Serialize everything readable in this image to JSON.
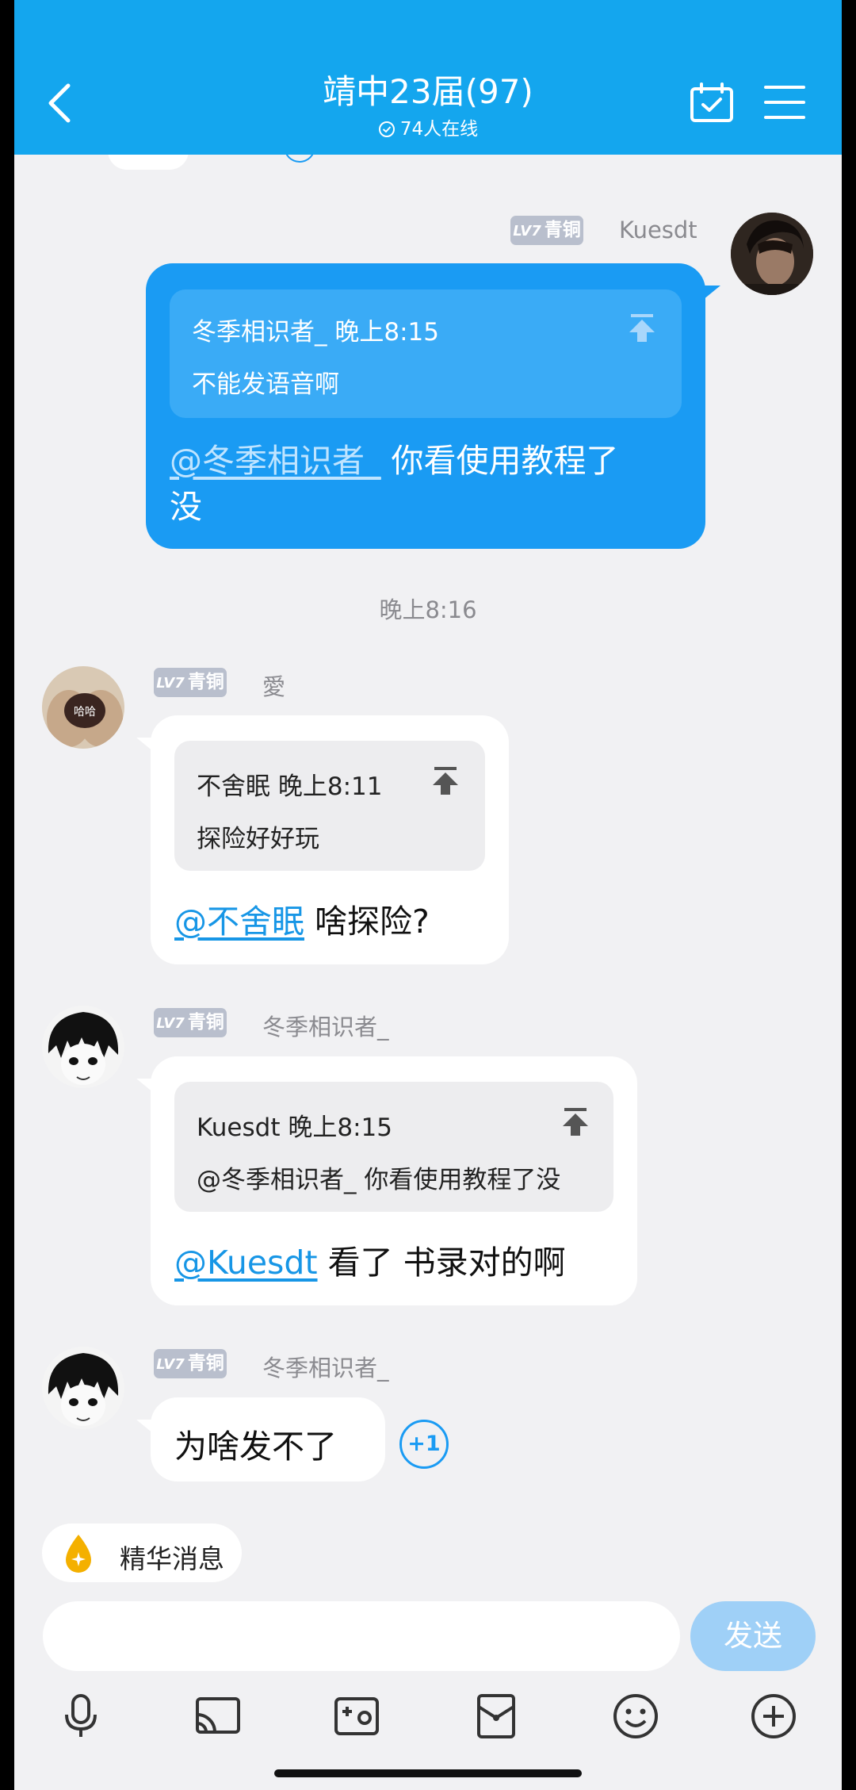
{
  "header": {
    "title": "靖中23届(97)",
    "online": "74人在线"
  },
  "messages": [
    {
      "sender": {
        "level": "LV7",
        "rank": "青铜",
        "name": "Kuesdt"
      },
      "quote": {
        "author_time": "冬季相识者_ 晚上8:15",
        "text": "不能发语音啊"
      },
      "mention": "@冬季相识者_",
      "text_line1": " 你看使用教程了",
      "text_line2": "没"
    },
    {
      "sender": {
        "level": "LV7",
        "rank": "青铜",
        "name": "愛"
      },
      "quote": {
        "author_time": "不舍眠 晚上8:11",
        "text": "探险好好玩"
      },
      "mention": "@不舍眠",
      "text": " 啥探险?"
    },
    {
      "sender": {
        "level": "LV7",
        "rank": "青铜",
        "name": "冬季相识者_"
      },
      "quote": {
        "author_time": "Kuesdt 晚上8:15",
        "text": "@冬季相识者_ 你看使用教程了没"
      },
      "mention": "@Kuesdt",
      "text": " 看了 书录对的啊"
    },
    {
      "sender": {
        "level": "LV7",
        "rank": "青铜",
        "name": "冬季相识者_"
      },
      "text": "为啥发不了",
      "plus_one": "+1"
    }
  ],
  "timestamp": "晚上8:16",
  "avatar_text": "哈哈",
  "essence_label": "精华消息",
  "input": {
    "value": "",
    "send_label": "发送"
  },
  "toolbar": [
    "microphone-icon",
    "screen-share-icon",
    "photo-icon",
    "red-packet-icon",
    "emoji-icon",
    "add-icon"
  ],
  "colors": {
    "header": "#14a6ee",
    "bubble_self": "#1a9bf3",
    "background": "#f1f1f3",
    "badge": "#b9bfcd",
    "mention": "#1796e6",
    "send_btn": "#9fd0f7"
  }
}
